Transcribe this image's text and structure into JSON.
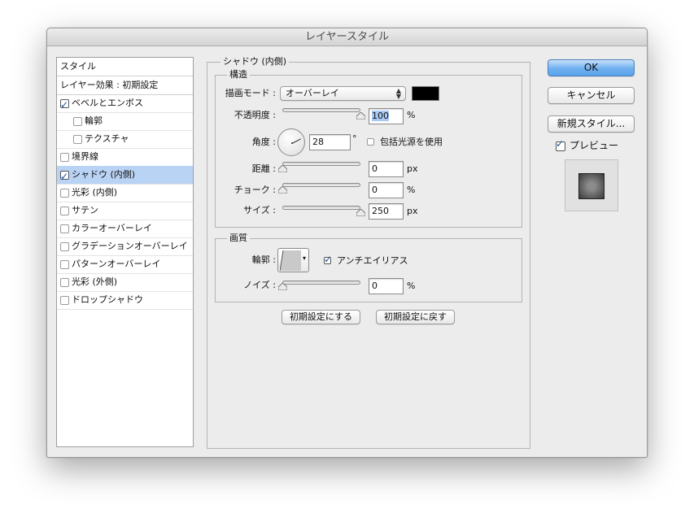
{
  "window": {
    "title": "レイヤースタイル"
  },
  "styles_panel": {
    "header": "スタイル",
    "items": [
      {
        "label": "レイヤー効果 : 初期設定",
        "has_checkbox": false,
        "checked": false,
        "indent": 0,
        "selected": false
      },
      {
        "label": "ベベルとエンボス",
        "has_checkbox": true,
        "checked": true,
        "indent": 0,
        "selected": false
      },
      {
        "label": "輪郭",
        "has_checkbox": true,
        "checked": false,
        "indent": 1,
        "selected": false
      },
      {
        "label": "テクスチャ",
        "has_checkbox": true,
        "checked": false,
        "indent": 1,
        "selected": false
      },
      {
        "label": "境界線",
        "has_checkbox": true,
        "checked": false,
        "indent": 0,
        "selected": false
      },
      {
        "label": "シャドウ (内側)",
        "has_checkbox": true,
        "checked": true,
        "indent": 0,
        "selected": true
      },
      {
        "label": "光彩 (内側)",
        "has_checkbox": true,
        "checked": false,
        "indent": 0,
        "selected": false
      },
      {
        "label": "サテン",
        "has_checkbox": true,
        "checked": false,
        "indent": 0,
        "selected": false
      },
      {
        "label": "カラーオーバーレイ",
        "has_checkbox": true,
        "checked": false,
        "indent": 0,
        "selected": false
      },
      {
        "label": "グラデーションオーバーレイ",
        "has_checkbox": true,
        "checked": false,
        "indent": 0,
        "selected": false
      },
      {
        "label": "パターンオーバーレイ",
        "has_checkbox": true,
        "checked": false,
        "indent": 0,
        "selected": false
      },
      {
        "label": "光彩 (外側)",
        "has_checkbox": true,
        "checked": false,
        "indent": 0,
        "selected": false
      },
      {
        "label": "ドロップシャドウ",
        "has_checkbox": true,
        "checked": false,
        "indent": 0,
        "selected": false
      }
    ]
  },
  "section": {
    "title": "シャドウ (内側)",
    "structure": {
      "title": "構造",
      "blend_mode": {
        "label": "描画モード :",
        "value": "オーバーレイ",
        "color": "#000000"
      },
      "opacity": {
        "label": "不透明度 :",
        "value": "100",
        "unit": "%",
        "slider_fraction": 1.0
      },
      "angle": {
        "label": "角度 :",
        "value": "28",
        "unit": "°",
        "degrees": 28,
        "global_light_label": "包括光源を使用",
        "global_light_checked": false
      },
      "distance": {
        "label": "距離 :",
        "value": "0",
        "unit": "px",
        "slider_fraction": 0.0
      },
      "choke": {
        "label": "チョーク :",
        "value": "0",
        "unit": "%",
        "slider_fraction": 0.0
      },
      "size": {
        "label": "サイズ :",
        "value": "250",
        "unit": "px",
        "slider_fraction": 1.0
      }
    },
    "quality": {
      "title": "画質",
      "contour": {
        "label": "輪郭 :",
        "antialias_label": "アンチエイリアス",
        "antialias_checked": true
      },
      "noise": {
        "label": "ノイズ :",
        "value": "0",
        "unit": "%",
        "slider_fraction": 0.0
      }
    },
    "buttons": {
      "make_default": "初期設定にする",
      "reset_default": "初期設定に戻す"
    }
  },
  "actions": {
    "ok": "OK",
    "cancel": "キャンセル",
    "new_style": "新規スタイル...",
    "preview_label": "プレビュー",
    "preview_checked": true
  },
  "colors": {
    "selection": "#b9d3f5",
    "default_button": "#6fb0f0",
    "window_bg": "#ececec"
  }
}
